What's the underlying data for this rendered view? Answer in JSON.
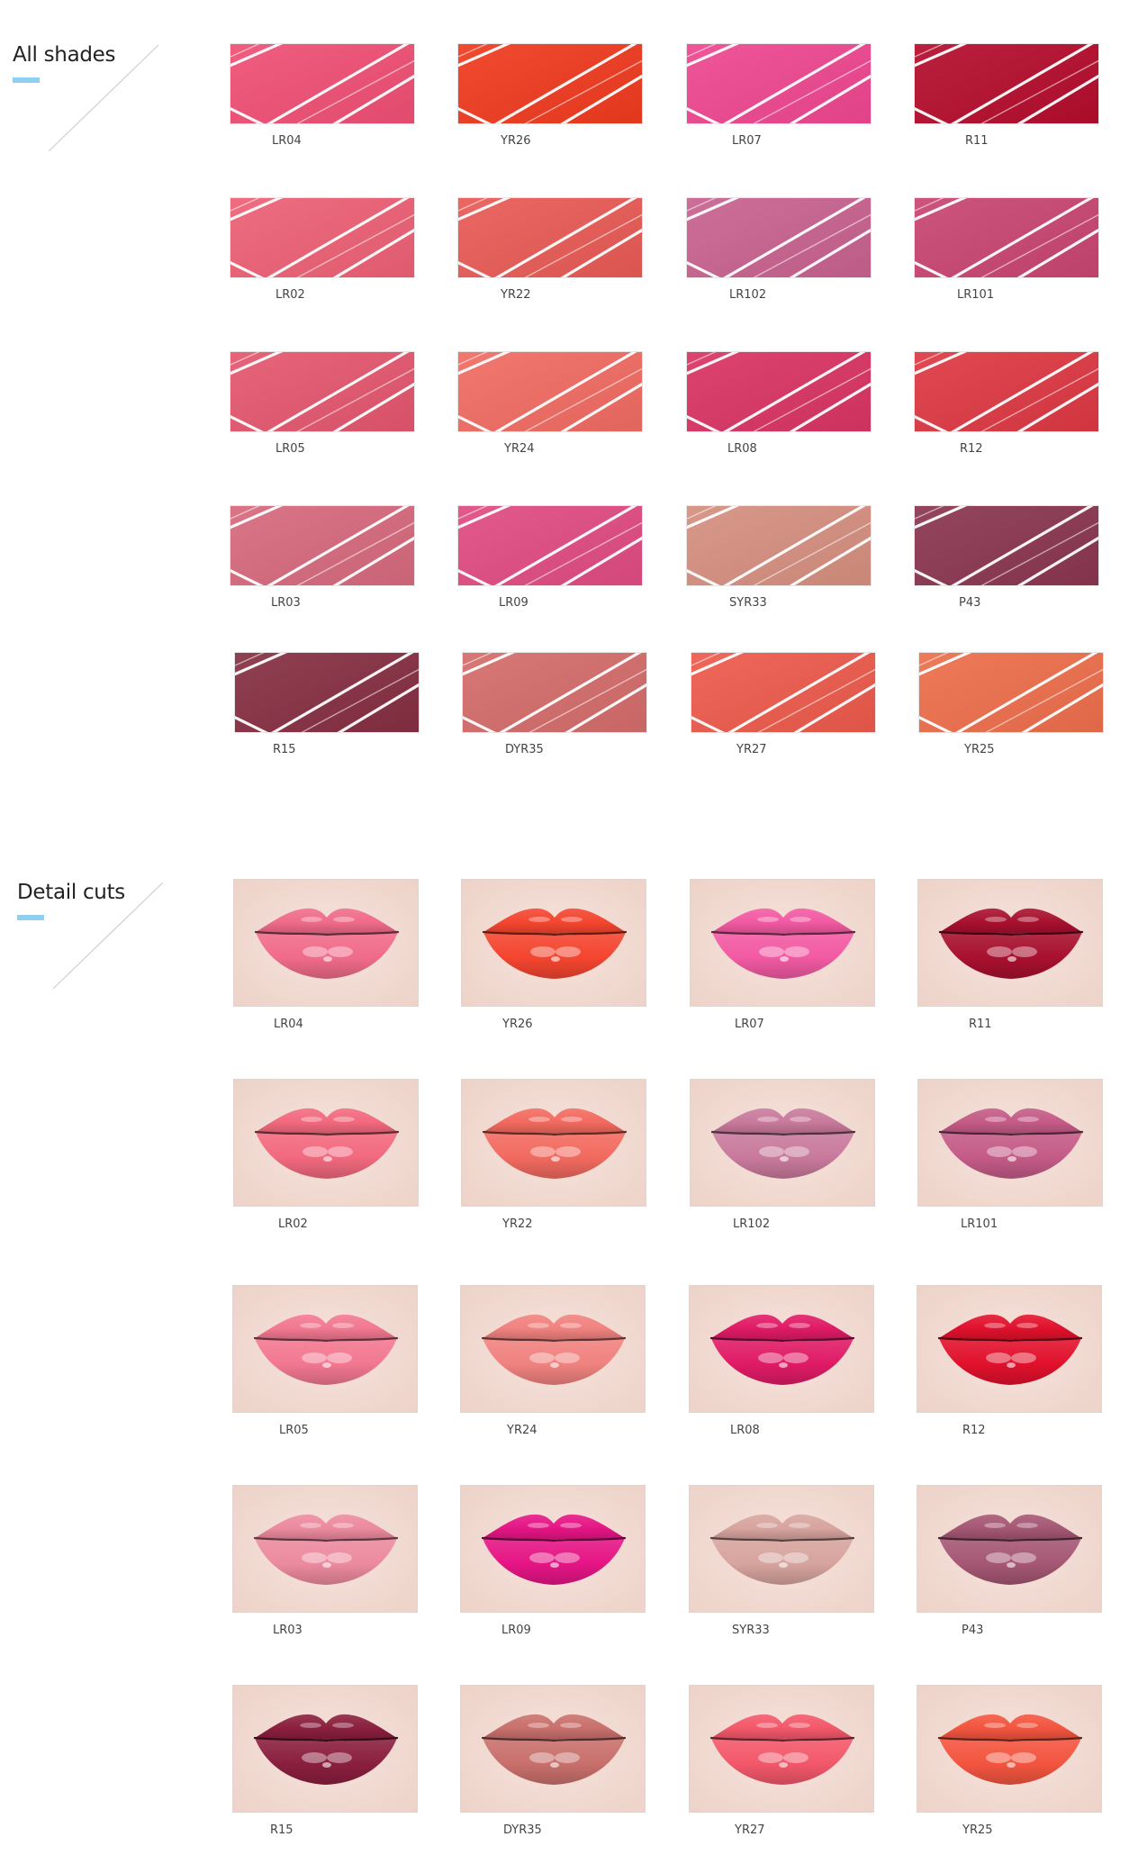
{
  "sections": {
    "all_shades": {
      "title": "All shades",
      "accent": "#8fd0f0"
    },
    "detail_cuts": {
      "title": "Detail cuts",
      "accent": "#8fd0f0"
    }
  },
  "shades": [
    {
      "code": "LR04",
      "color": "#ef4f74"
    },
    {
      "code": "YR26",
      "color": "#ef3a1f"
    },
    {
      "code": "LR07",
      "color": "#ee4690"
    },
    {
      "code": "R11",
      "color": "#b40d2c"
    },
    {
      "code": "LR02",
      "color": "#ed6075"
    },
    {
      "code": "YR22",
      "color": "#e85a55"
    },
    {
      "code": "LR102",
      "color": "#c8628f"
    },
    {
      "code": "LR101",
      "color": "#c84572"
    },
    {
      "code": "LR05",
      "color": "#e4566e"
    },
    {
      "code": "YR24",
      "color": "#f06b63"
    },
    {
      "code": "LR08",
      "color": "#d93463"
    },
    {
      "code": "R12",
      "color": "#dd3843"
    },
    {
      "code": "LR03",
      "color": "#d6697d"
    },
    {
      "code": "LR09",
      "color": "#e04b82"
    },
    {
      "code": "SYR33",
      "color": "#d58f7f"
    },
    {
      "code": "P43",
      "color": "#8a3650"
    },
    {
      "code": "R15",
      "color": "#852f42"
    },
    {
      "code": "DYR35",
      "color": "#d46c6a"
    },
    {
      "code": "YR27",
      "color": "#ec5a4c"
    },
    {
      "code": "YR25",
      "color": "#ec6e4c"
    }
  ],
  "lips": [
    {
      "code": "LR04",
      "color": "#f06b8a"
    },
    {
      "code": "YR26",
      "color": "#f4452f"
    },
    {
      "code": "LR07",
      "color": "#f25aa3"
    },
    {
      "code": "R11",
      "color": "#a8102e"
    },
    {
      "code": "LR02",
      "color": "#f2697e"
    },
    {
      "code": "YR22",
      "color": "#f26a5f"
    },
    {
      "code": "LR102",
      "color": "#c97a9c"
    },
    {
      "code": "LR101",
      "color": "#c45b87"
    },
    {
      "code": "LR05",
      "color": "#f27891"
    },
    {
      "code": "YR24",
      "color": "#f0827f"
    },
    {
      "code": "LR08",
      "color": "#e01b66"
    },
    {
      "code": "R12",
      "color": "#e1112c"
    },
    {
      "code": "LR03",
      "color": "#ec8a9f"
    },
    {
      "code": "LR09",
      "color": "#e51585"
    },
    {
      "code": "SYR33",
      "color": "#d7a49e"
    },
    {
      "code": "P43",
      "color": "#a55773"
    },
    {
      "code": "R15",
      "color": "#8a1f3e"
    },
    {
      "code": "DYR35",
      "color": "#c9706c"
    },
    {
      "code": "YR27",
      "color": "#f3586a"
    },
    {
      "code": "YR25",
      "color": "#f3553f"
    }
  ]
}
